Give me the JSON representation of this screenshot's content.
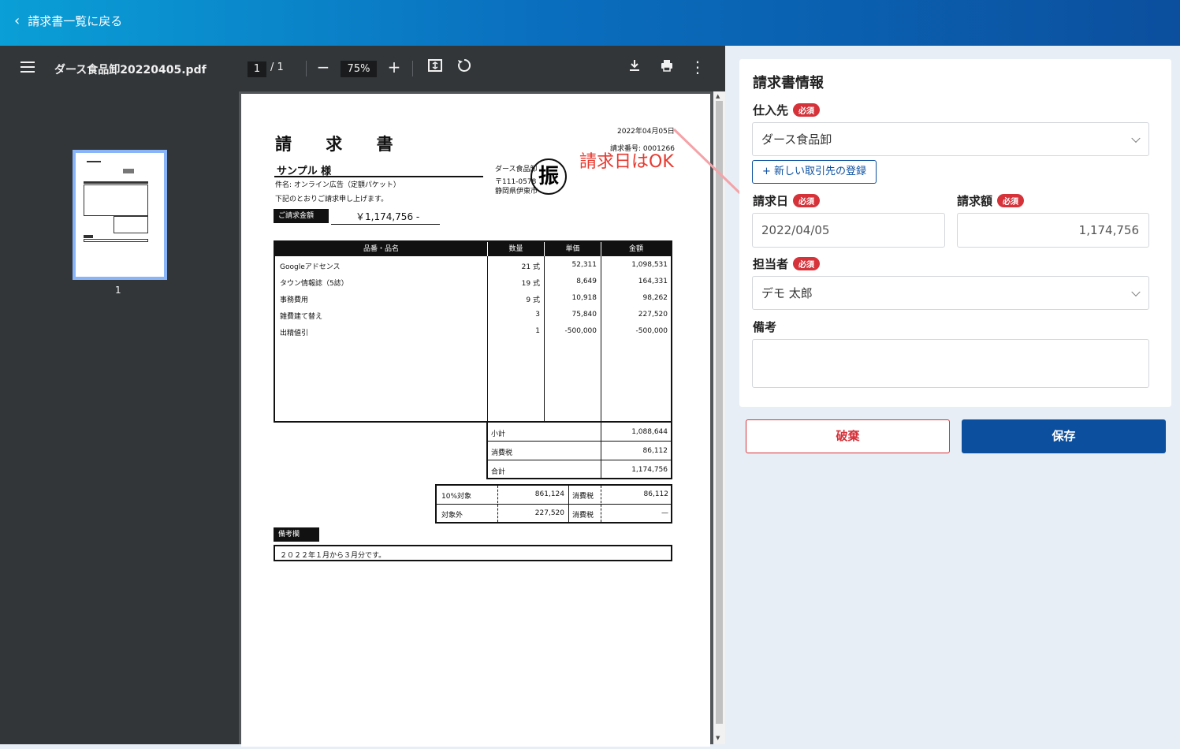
{
  "header": {
    "back_label": "請求書一覧に戻る"
  },
  "viewer": {
    "filename": "ダース食品卸20220405.pdf",
    "current_page": "1",
    "total_pages": "1",
    "zoom": "75%",
    "thumbnail_label": "1"
  },
  "pdf": {
    "date": "2022年04月05日",
    "title": "請 求 書",
    "invoice_no": "請求番号: 0001266",
    "customer": "サンプル 様",
    "subject": "件名: オンライン広告（定額パケット）",
    "note_line": "下記のとおりご請求申し上げます。",
    "amount_label": "ご請求金額",
    "amount_value": "￥1,174,756 -",
    "issuer_name": "ダース食品卸",
    "issuer_zip": "〒111-0578",
    "issuer_addr": "静岡県伊東市",
    "stamp": "振",
    "headers": [
      "品番・品名",
      "数量",
      "単価",
      "金額"
    ],
    "rows": [
      [
        "Googleアドセンス",
        "21 式",
        "52,311",
        "1,098,531"
      ],
      [
        "タウン情報誌（5誌）",
        "19 式",
        "8,649",
        "164,331"
      ],
      [
        "事務費用",
        "9 式",
        "10,918",
        "98,262"
      ],
      [
        "雑費建て替え",
        "3",
        "75,840",
        "227,520"
      ],
      [
        "出精値引",
        "1",
        "-500,000",
        "-500,000"
      ]
    ],
    "subtotal_label": "小計",
    "subtotal": "1,088,644",
    "tax_label": "消費税",
    "tax": "86,112",
    "total_label": "合計",
    "total": "1,174,756",
    "tax10_label": "10%対象",
    "tax10_base": "861,124",
    "tax10_tax_label": "消費税",
    "tax10_tax": "86,112",
    "exempt_label": "対象外",
    "exempt_base": "227,520",
    "exempt_tax_label": "消費税",
    "exempt_tax": "—",
    "remarks_label": "備考欄",
    "remarks": "２０２２年１月から３月分です。"
  },
  "annotation": "請求日はOK",
  "form": {
    "title": "請求書情報",
    "required_badge": "必須",
    "supplier_label": "仕入先",
    "supplier_value": "ダース食品卸",
    "new_supplier_button": "+ 新しい取引先の登録",
    "date_label": "請求日",
    "date_value": "2022/04/05",
    "amount_label": "請求額",
    "amount_value": "1,174,756",
    "person_label": "担当者",
    "person_value": "デモ 太郎",
    "remarks_label": "備考",
    "remarks_value": ""
  },
  "actions": {
    "discard": "破棄",
    "save": "保存"
  },
  "colors": {
    "primary": "#0b4f9e",
    "required": "#d6323a",
    "annotation": "#e8392f"
  }
}
